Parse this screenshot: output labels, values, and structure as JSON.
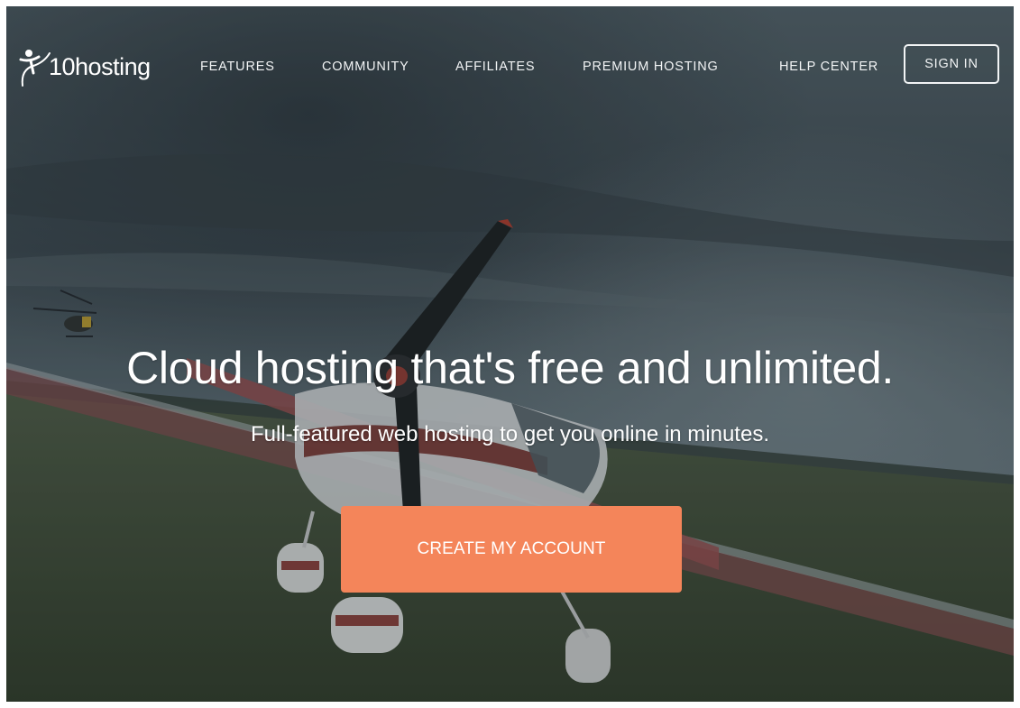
{
  "brand": {
    "logo_text": "10hosting",
    "logo_icon": "figure-swoosh-icon"
  },
  "nav": {
    "items": [
      {
        "label": "FEATURES"
      },
      {
        "label": "COMMUNITY"
      },
      {
        "label": "AFFILIATES"
      },
      {
        "label": "PREMIUM HOSTING"
      },
      {
        "label": "HELP CENTER"
      }
    ],
    "signin_label": "SIGN IN"
  },
  "hero": {
    "title": "Cloud hosting that's free and unlimited.",
    "subtitle": "Full-featured web hosting to get you online in minutes.",
    "cta_label": "CREATE MY ACCOUNT"
  },
  "colors": {
    "accent": "#f4855a",
    "nav_text": "#f2f4f5",
    "sky": "#46565d",
    "grass": "#3c4a33"
  }
}
